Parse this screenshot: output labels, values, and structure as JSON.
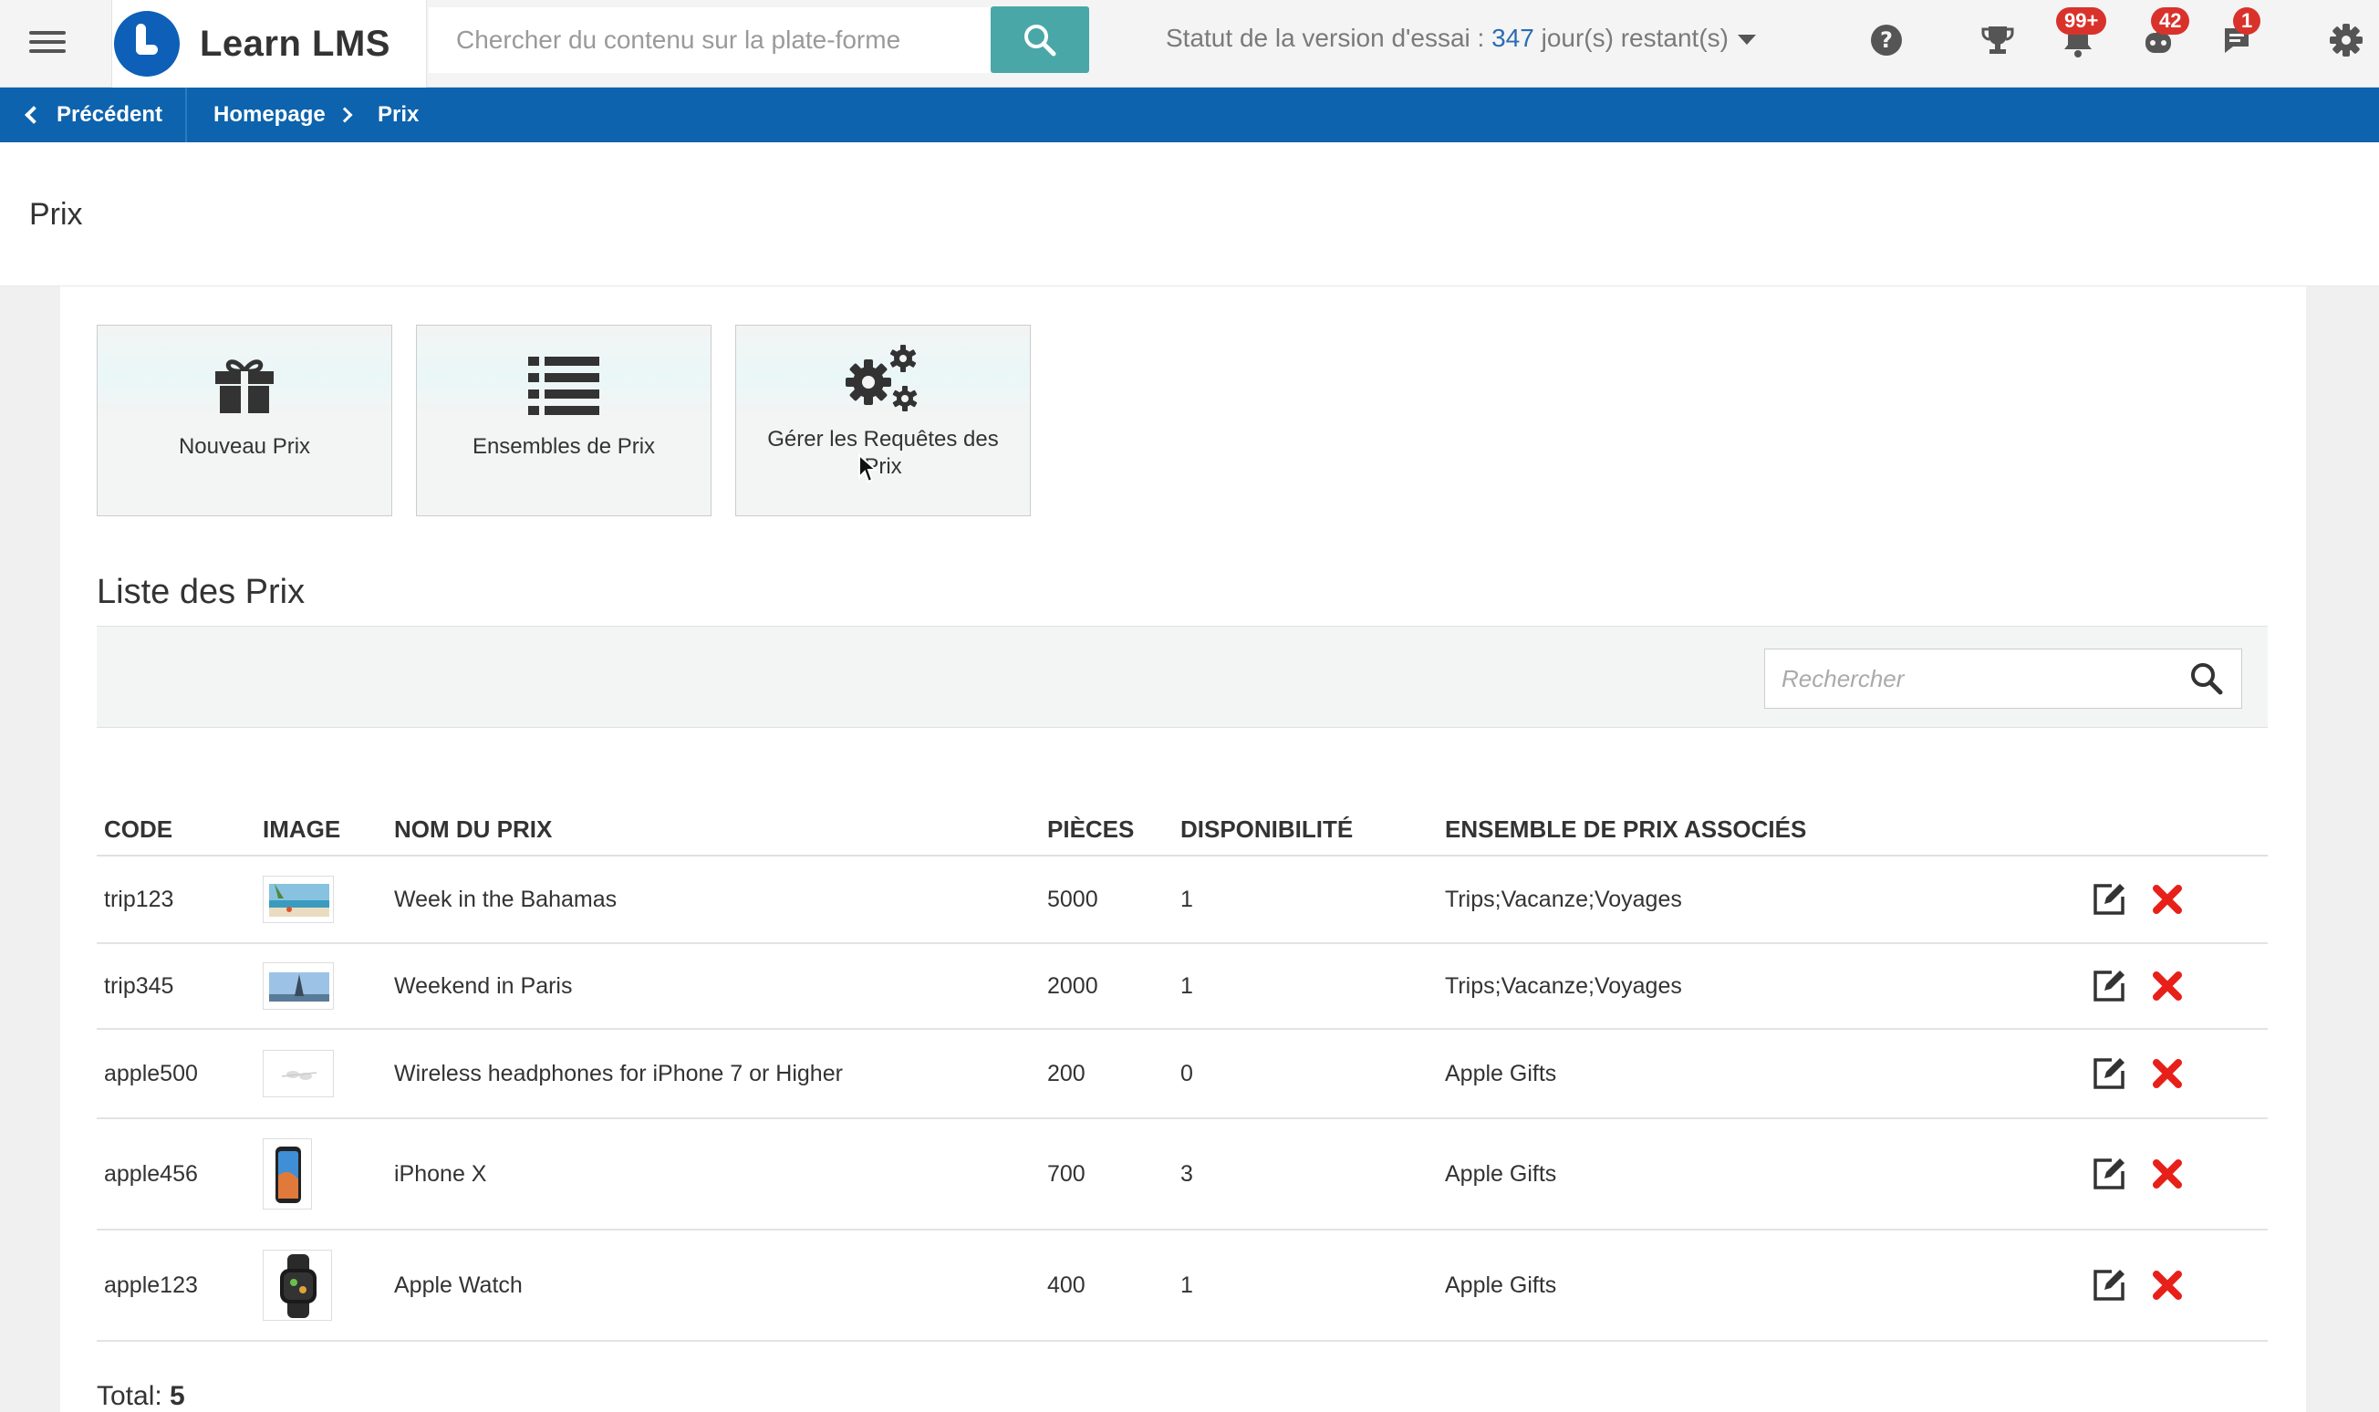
{
  "header": {
    "app_name": "Learn LMS",
    "search_placeholder": "Chercher du contenu sur la plate-forme",
    "trial_prefix": "Statut de la version d'essai : ",
    "trial_days": "347",
    "trial_suffix": " jour(s) restant(s)",
    "badges": {
      "notifications": "99+",
      "bot": "42",
      "messages": "1"
    }
  },
  "breadcrumb": {
    "back_label": "Précédent",
    "items": [
      "Homepage",
      "Prix"
    ]
  },
  "page": {
    "title": "Prix"
  },
  "tiles": [
    {
      "label": "Nouveau Prix",
      "icon": "gift-icon"
    },
    {
      "label": "Ensembles de Prix",
      "icon": "list-icon"
    },
    {
      "label": "Gérer les Requêtes des Prix",
      "icon": "gears-icon"
    }
  ],
  "list": {
    "title": "Liste des Prix",
    "search_placeholder": "Rechercher",
    "columns": [
      "CODE",
      "IMAGE",
      "NOM DU PRIX",
      "PIÈCES",
      "DISPONIBILITÉ",
      "ENSEMBLE DE PRIX ASSOCIÉS"
    ],
    "rows": [
      {
        "code": "trip123",
        "name": "Week in the Bahamas",
        "pieces": "5000",
        "availability": "1",
        "sets": "Trips;Vacanze;Voyages",
        "image": "beach"
      },
      {
        "code": "trip345",
        "name": "Weekend in Paris",
        "pieces": "2000",
        "availability": "1",
        "sets": "Trips;Vacanze;Voyages",
        "image": "paris"
      },
      {
        "code": "apple500",
        "name": "Wireless headphones for iPhone 7 or Higher",
        "pieces": "200",
        "availability": "0",
        "sets": "Apple Gifts",
        "image": "earbuds"
      },
      {
        "code": "apple456",
        "name": "iPhone X",
        "pieces": "700",
        "availability": "3",
        "sets": "Apple Gifts",
        "image": "phone"
      },
      {
        "code": "apple123",
        "name": "Apple Watch",
        "pieces": "400",
        "availability": "1",
        "sets": "Apple Gifts",
        "image": "watch"
      }
    ],
    "total_label": "Total: ",
    "total_value": "5"
  },
  "colors": {
    "primary": "#0d63ad",
    "search_button": "#4aa7a7",
    "delete": "#e8201a",
    "badge": "#d9322b"
  }
}
